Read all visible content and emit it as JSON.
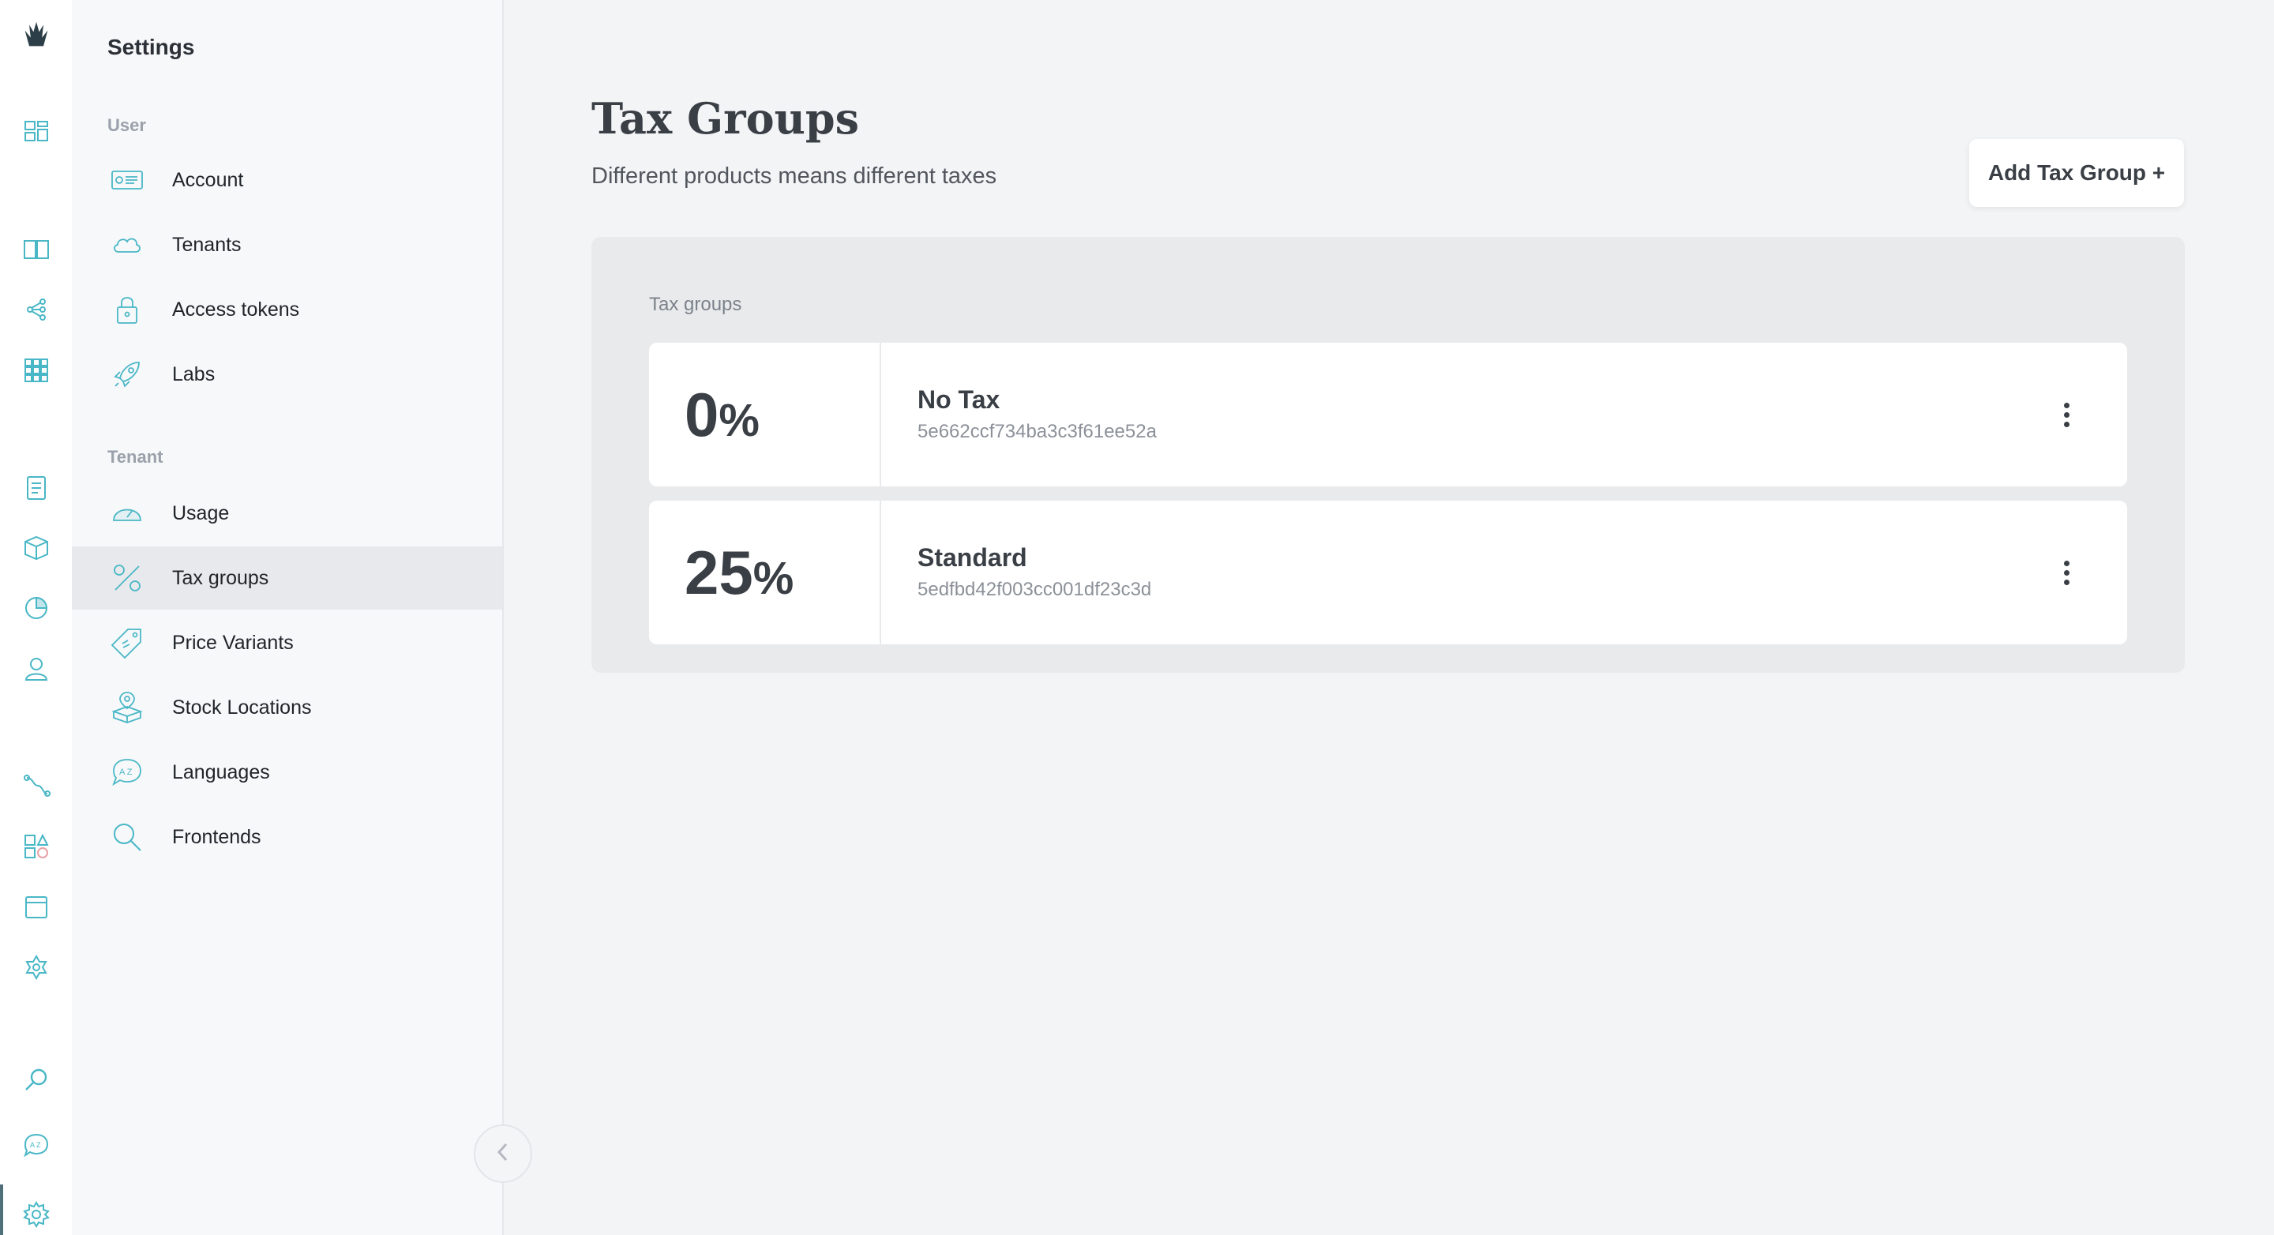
{
  "colors": {
    "accent": "#49b7c6",
    "active_bar": "#4f6f7a"
  },
  "rail": {
    "icons": [
      "brand-logo-icon",
      "dashboard-icon",
      "catalogue-icon",
      "shapes-icon",
      "grid-icon",
      "orders-icon",
      "product-box-icon",
      "reports-icon",
      "customers-icon",
      "pipelines-icon",
      "components-icon",
      "frontend-icon",
      "webhooks-icon",
      "search-icon",
      "languages-icon",
      "settings-icon"
    ]
  },
  "settings": {
    "title": "Settings",
    "user_label": "User",
    "tenant_label": "Tenant",
    "user_items": [
      {
        "label": "Account",
        "icon": "id-card-icon"
      },
      {
        "label": "Tenants",
        "icon": "cloud-icon"
      },
      {
        "label": "Access tokens",
        "icon": "lock-icon"
      },
      {
        "label": "Labs",
        "icon": "rocket-icon"
      }
    ],
    "tenant_items": [
      {
        "label": "Usage",
        "icon": "speedometer-icon"
      },
      {
        "label": "Tax groups",
        "icon": "percent-icon"
      },
      {
        "label": "Price Variants",
        "icon": "price-tag-icon"
      },
      {
        "label": "Stock Locations",
        "icon": "location-box-icon"
      },
      {
        "label": "Languages",
        "icon": "speech-bubble-icon"
      },
      {
        "label": "Frontends",
        "icon": "magnifier-icon"
      }
    ],
    "active_item": "Tax groups"
  },
  "main": {
    "title": "Tax Groups",
    "subtitle": "Different products means different taxes",
    "add_button": "Add Tax Group +",
    "section_label": "Tax groups",
    "groups": [
      {
        "rate": "0",
        "percent": "%",
        "name": "No Tax",
        "id": "5e662ccf734ba3c3f61ee52a"
      },
      {
        "rate": "25",
        "percent": "%",
        "name": "Standard",
        "id": "5edfbd42f003cc001df23c3d"
      }
    ]
  }
}
